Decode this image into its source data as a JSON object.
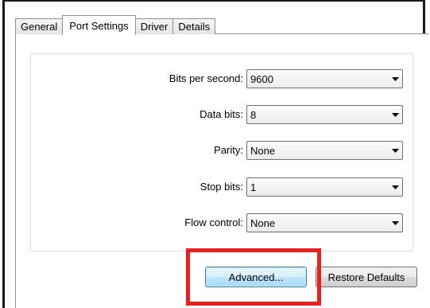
{
  "tabs": [
    {
      "label": "General"
    },
    {
      "label": "Port Settings"
    },
    {
      "label": "Driver"
    },
    {
      "label": "Details"
    }
  ],
  "active_tab": "Port Settings",
  "fields": {
    "bits_per_second": {
      "label": "Bits per second:",
      "value": "9600"
    },
    "data_bits": {
      "label": "Data bits:",
      "value": "8"
    },
    "parity": {
      "label": "Parity:",
      "value": "None"
    },
    "stop_bits": {
      "label": "Stop bits:",
      "value": "1"
    },
    "flow_control": {
      "label": "Flow control:",
      "value": "None"
    }
  },
  "buttons": {
    "advanced_label": "Advanced...",
    "restore_defaults_label": "Restore Defaults"
  },
  "icons": {
    "dropdown_arrow": "chevron-down-icon"
  },
  "colors": {
    "highlight": "#e8201f",
    "focus_border": "#3c7fb1"
  }
}
